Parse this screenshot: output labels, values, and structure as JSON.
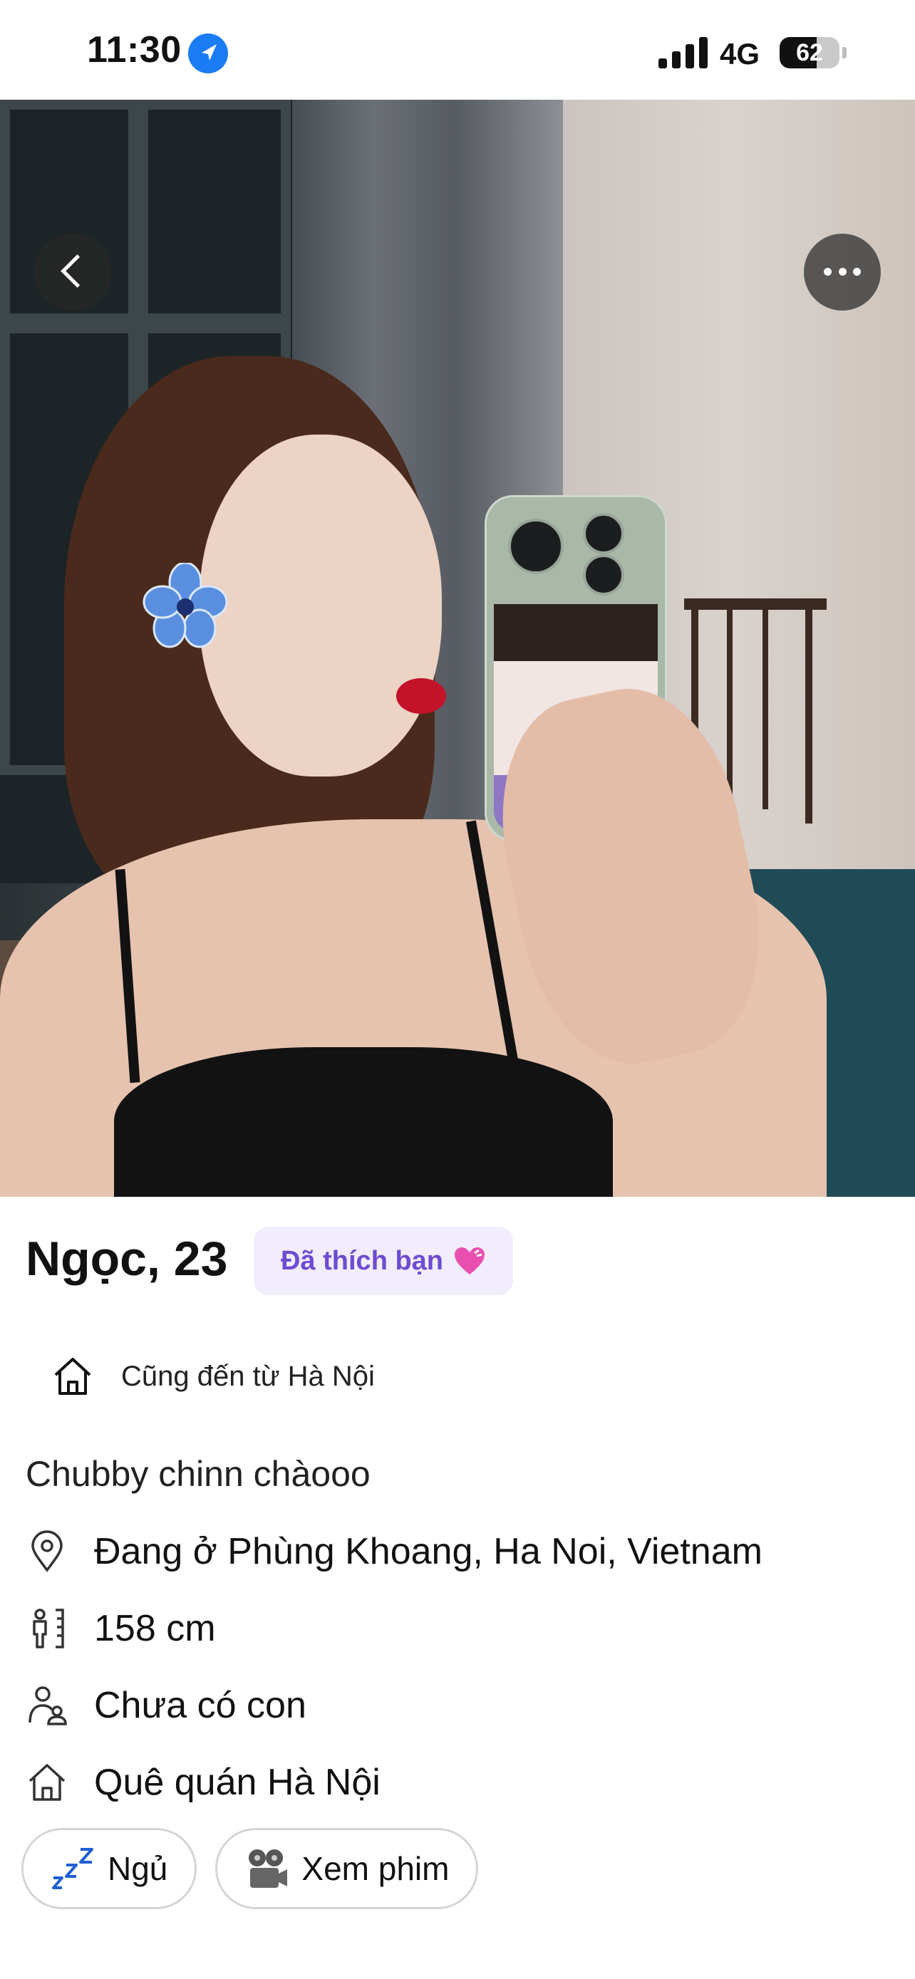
{
  "status_bar": {
    "time": "11:30",
    "network": "4G",
    "battery": "62",
    "battery_level": 0.62,
    "location_icon": "location-arrow-icon",
    "signal_icon": "cellular-signal-icon"
  },
  "profile": {
    "name_age": "Ngọc, 23",
    "liked_badge": "Đã thích bạn",
    "liked_icon": "heart-icon",
    "shared_hometown": "Cũng đến từ Hà Nội",
    "bio": "Chubby chinn chàooo",
    "details": [
      {
        "icon": "location-pin-icon",
        "text": "Đang ở Phùng Khoang, Ha Noi, Vietnam"
      },
      {
        "icon": "height-icon",
        "text": "158 cm"
      },
      {
        "icon": "family-icon",
        "text": "Chưa có con"
      },
      {
        "icon": "home-icon",
        "text": "Quê quán Hà Nội"
      }
    ],
    "interests": [
      {
        "icon": "zzz-icon",
        "label": "Ngủ"
      },
      {
        "icon": "film-projector-icon",
        "label": "Xem phim"
      }
    ]
  },
  "colors": {
    "accent_purple": "#6d4cd3",
    "badge_bg": "#f2edfd",
    "overlay_button": "#282828"
  }
}
